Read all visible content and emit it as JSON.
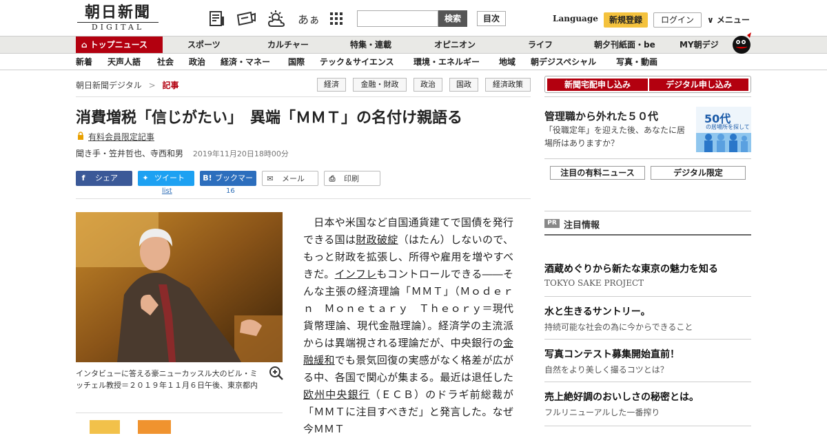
{
  "header": {
    "logo_jp": "朝日新聞",
    "logo_en": "DIGITAL",
    "search_button": "検索",
    "toc_button": "目次",
    "language": "Language",
    "register": "新規登録",
    "login": "ログイン",
    "menu": "∨ メニュー",
    "font_size_label": "あぁ"
  },
  "nav_primary": [
    "トップニュース",
    "スポーツ",
    "カルチャー",
    "特集・連載",
    "オピニオン",
    "ライフ",
    "朝夕刊紙面・be",
    "MY朝デジ"
  ],
  "nav_secondary": [
    "新着",
    "天声人語",
    "社会",
    "政治",
    "経済・マネー",
    "国際",
    "テック＆サイエンス",
    "環境・エネルギー",
    "地域",
    "朝デジスペシャル",
    "写真・動画"
  ],
  "breadcrumb": {
    "root": "朝日新聞デジタル",
    "sep": ">",
    "current": "記事"
  },
  "tags": [
    "経済",
    "金融・財政",
    "政治",
    "国政",
    "経済政策"
  ],
  "article": {
    "title": "消費増税「信じがたい」　異端「ＭＭＴ」の名付け親語る",
    "member_only": "有料会員限定記事",
    "byline": "聞き手・笠井哲也、寺西和男",
    "date": "2019年11月20日18時00分",
    "share": {
      "facebook": "シェア",
      "twitter": "ツイート",
      "twitter_count": "list",
      "hatena": "ブックマーク",
      "hatena_count": "16",
      "mail": "メール",
      "print": "印刷"
    },
    "caption": "インタビューに答える豪ニューカッスル大のビル・ミッチェル教授＝２０１９年１１月６日午後、東京都内",
    "body": {
      "p1": "　日本や米国など自国通貨建てで国債を発行できる国は",
      "link1": "財政破綻",
      "p2": "（はたん）しないので、もっと財政を拡張し、所得や雇用を増やすべきだ。",
      "link2": "インフレ",
      "p3": "もコントロールできる――そんな主張の経済理論「ＭＭＴ」（Ｍｏｄｅｒｎ　Ｍｏｎｅｔａｒｙ　Ｔｈｅｏｒｙ＝現代貨幣理論、現代金融理論）。経済学の主流派からは異端視される理論だが、中央銀行の",
      "link3": "金融緩和",
      "p4": "でも景気回復の実感がなく格差が広がる中、各国で関心が集まる。最近は退任した",
      "link4": "欧州中央銀行",
      "p5": "（ＥＣＢ）のドラギ前総裁が「ＭＭＴに注目すべきだ」と発言した。なぜ今ＭＭＴ"
    }
  },
  "sidebar": {
    "btn_newspaper": "新聞宅配申し込み",
    "btn_digital": "デジタル申し込み",
    "promo_title": "管理職から外れた５０代",
    "promo_desc": "「役職定年」を迎えた後、あなたに居場所はありますか？",
    "promo_img_text": "50代",
    "promo_img_sub": "の居場所を探して",
    "tab_paid": "注目の有料ニュース",
    "tab_digital": "デジタル限定",
    "pr_badge": "PR",
    "pr_title": "注目情報",
    "ads": [
      {
        "title": "酒蔵めぐりから新たな東京の魅力を知る",
        "sub": "TOKYO SAKE PROJECT"
      },
      {
        "title": "水と生きるサントリー。",
        "sub": "持続可能な社会の為に今からできること"
      },
      {
        "title": "写真コンテスト募集開始直前！",
        "sub": "自然をより美しく撮るコツとは？"
      },
      {
        "title": "売上絶好調のおいしさの秘密とは。",
        "sub": "フルリニューアルした一番搾り"
      }
    ]
  },
  "colors": {
    "brand_red": "#b3000f",
    "register_yellow": "#f4c23d",
    "facebook": "#3b5998",
    "twitter": "#1da1f2",
    "hatena": "#2c6ebd"
  }
}
